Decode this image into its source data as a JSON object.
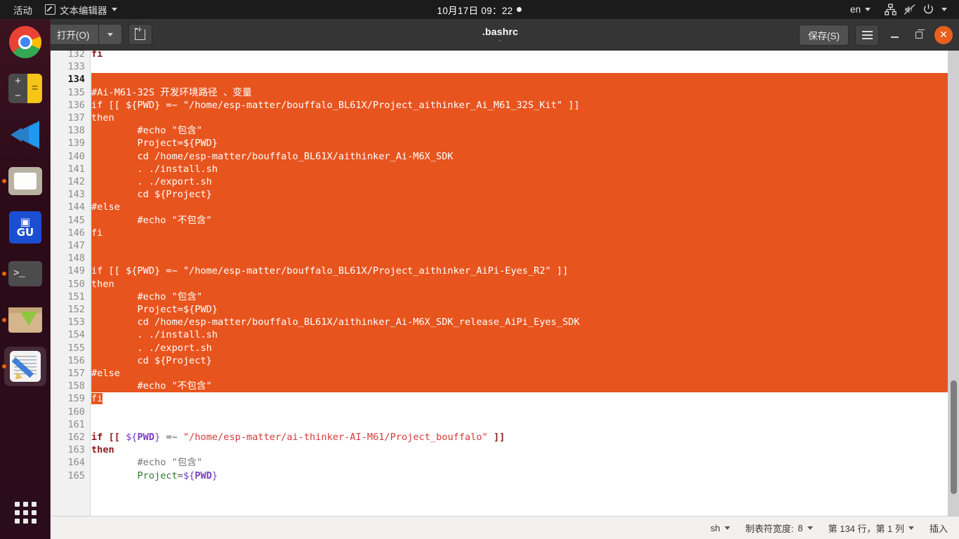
{
  "topbar": {
    "activities": "活动",
    "app_name": "文本编辑器",
    "clock": "10月17日  09：22",
    "language": "en",
    "icons": [
      "network-icon",
      "volume-muted-icon",
      "power-icon",
      "system-menu-caret"
    ]
  },
  "dock": {
    "items": [
      {
        "name": "google-chrome",
        "running": false
      },
      {
        "name": "calculator",
        "running": false
      },
      {
        "name": "visual-studio-code",
        "running": false
      },
      {
        "name": "files",
        "running": true
      },
      {
        "name": "gui-app",
        "running": false
      },
      {
        "name": "terminal",
        "running": true
      },
      {
        "name": "software-archive",
        "running": true
      },
      {
        "name": "text-editor",
        "running": true,
        "selected": true
      }
    ],
    "show_applications": "show-applications-grid"
  },
  "headerbar": {
    "open_label": "打开(O)",
    "open_dropdown": "open-dropdown-caret",
    "new_document": "new-document-icon",
    "title": ".bashrc",
    "subtitle": "~",
    "save_label": "保存(S)",
    "menu": "hamburger-menu-icon",
    "minimize": "minimize-icon",
    "maximize": "maximize-icon",
    "close": "✕"
  },
  "statusbar": {
    "language": "sh",
    "tab_width_label": "制表符宽度:",
    "tab_width_value": "8",
    "position": "第 134 行，第 1 列",
    "mode": "插入"
  },
  "editor": {
    "first_partial_line": "        #echo \"不包含\"",
    "selection_color": "#e8541e",
    "current_line": 134,
    "lines": [
      {
        "n": 132,
        "sel": false,
        "text": "fi"
      },
      {
        "n": 133,
        "sel": false,
        "text": ""
      },
      {
        "n": 134,
        "sel": true,
        "text": ""
      },
      {
        "n": 135,
        "sel": true,
        "text": "#Ai-M61-32S 开发环境路径 、变量"
      },
      {
        "n": 136,
        "sel": true,
        "text": "if [[ ${PWD} =~ \"/home/esp-matter/bouffalo_BL61X/Project_aithinker_Ai_M61_32S_Kit\" ]]"
      },
      {
        "n": 137,
        "sel": true,
        "text": "then"
      },
      {
        "n": 138,
        "sel": true,
        "text": "        #echo \"包含\""
      },
      {
        "n": 139,
        "sel": true,
        "text": "        Project=${PWD}"
      },
      {
        "n": 140,
        "sel": true,
        "text": "        cd /home/esp-matter/bouffalo_BL61X/aithinker_Ai-M6X_SDK"
      },
      {
        "n": 141,
        "sel": true,
        "text": "        . ./install.sh"
      },
      {
        "n": 142,
        "sel": true,
        "text": "        . ./export.sh"
      },
      {
        "n": 143,
        "sel": true,
        "text": "        cd ${Project}"
      },
      {
        "n": 144,
        "sel": true,
        "text": "#else"
      },
      {
        "n": 145,
        "sel": true,
        "text": "        #echo \"不包含\""
      },
      {
        "n": 146,
        "sel": true,
        "text": "fi"
      },
      {
        "n": 147,
        "sel": true,
        "text": ""
      },
      {
        "n": 148,
        "sel": true,
        "text": ""
      },
      {
        "n": 149,
        "sel": true,
        "text": "if [[ ${PWD} =~ \"/home/esp-matter/bouffalo_BL61X/Project_aithinker_AiPi-Eyes_R2\" ]]"
      },
      {
        "n": 150,
        "sel": true,
        "text": "then"
      },
      {
        "n": 151,
        "sel": true,
        "text": "        #echo \"包含\""
      },
      {
        "n": 152,
        "sel": true,
        "text": "        Project=${PWD}"
      },
      {
        "n": 153,
        "sel": true,
        "text": "        cd /home/esp-matter/bouffalo_BL61X/aithinker_Ai-M6X_SDK_release_AiPi_Eyes_SDK"
      },
      {
        "n": 154,
        "sel": true,
        "text": "        . ./install.sh"
      },
      {
        "n": 155,
        "sel": true,
        "text": "        . ./export.sh"
      },
      {
        "n": 156,
        "sel": true,
        "text": "        cd ${Project}"
      },
      {
        "n": 157,
        "sel": true,
        "text": "#else"
      },
      {
        "n": 158,
        "sel": true,
        "text": "        #echo \"不包含\""
      },
      {
        "n": 159,
        "sel": "partial",
        "text": "fi"
      },
      {
        "n": 160,
        "sel": false,
        "text": ""
      },
      {
        "n": 161,
        "sel": false,
        "text": ""
      },
      {
        "n": 162,
        "sel": false,
        "text": "if [[ ${PWD} =~ \"/home/esp-matter/ai-thinker-AI-M61/Project_bouffalo\" ]]"
      },
      {
        "n": 163,
        "sel": false,
        "text": "then"
      },
      {
        "n": 164,
        "sel": false,
        "text": "        #echo \"包含\""
      },
      {
        "n": 165,
        "sel": false,
        "text": "        Project=${PWD}"
      }
    ]
  }
}
